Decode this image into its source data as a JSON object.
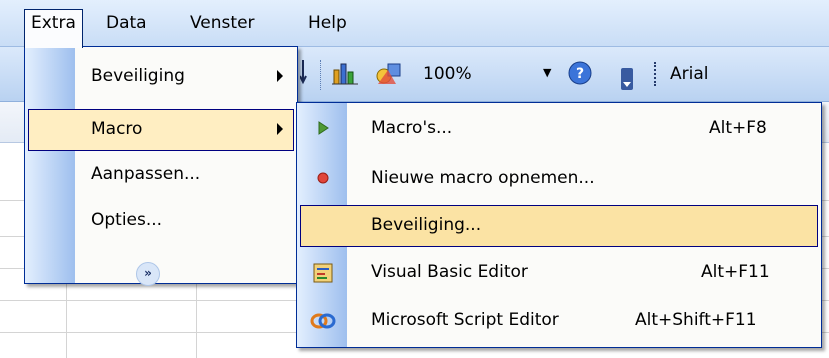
{
  "menubar": {
    "items": [
      {
        "label": "Extra"
      },
      {
        "label": "Data"
      },
      {
        "label": "Venster"
      },
      {
        "label": "Help"
      }
    ]
  },
  "toolbar": {
    "zoom": "100%",
    "font": "Arial"
  },
  "extra_menu": {
    "items": [
      {
        "label": "Beveiliging"
      },
      {
        "label": "Macro"
      },
      {
        "label": "Aanpassen..."
      },
      {
        "label": "Opties..."
      }
    ]
  },
  "macro_submenu": {
    "items": [
      {
        "label": "Macro's...",
        "shortcut": "Alt+F8",
        "icon": "play-icon"
      },
      {
        "label": "Nieuwe macro opnemen...",
        "shortcut": "",
        "icon": "record-icon"
      },
      {
        "label": "Beveiliging...",
        "shortcut": "",
        "icon": ""
      },
      {
        "label": "Visual Basic Editor",
        "shortcut": "Alt+F11",
        "icon": "vb-editor-icon"
      },
      {
        "label": "Microsoft Script Editor",
        "shortcut": "Alt+Shift+F11",
        "icon": "script-editor-icon"
      }
    ]
  },
  "colors": {
    "highlight": "#ffeec2",
    "menu_border": "#002d96",
    "strip_dark": "#9ebfee"
  }
}
